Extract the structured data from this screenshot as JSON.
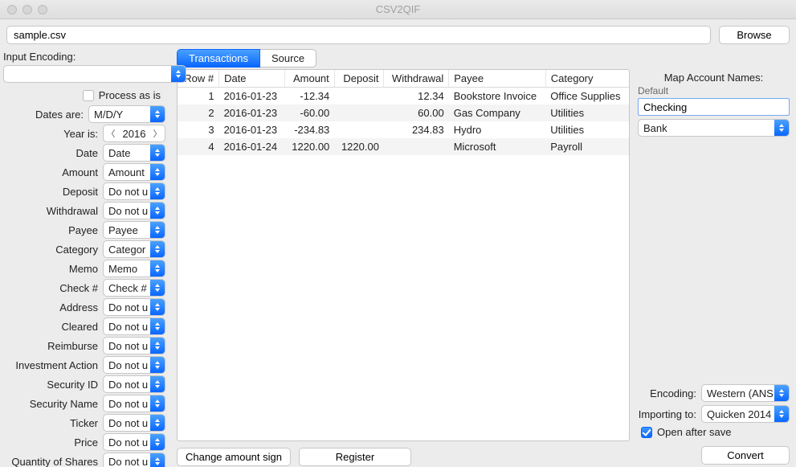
{
  "window": {
    "title": "CSV2QIF"
  },
  "file": {
    "path": "sample.csv",
    "browse": "Browse"
  },
  "left": {
    "input_encoding_label": "Input Encoding:",
    "input_encoding_value": "",
    "process_as_is": "Process as is",
    "dates_are_label": "Dates are:",
    "dates_are_value": "M/D/Y",
    "year_is_label": "Year is:",
    "year_value": "2016",
    "fields": [
      {
        "label": "Date",
        "value": "Date"
      },
      {
        "label": "Amount",
        "value": "Amount"
      },
      {
        "label": "Deposit",
        "value": "Do not u"
      },
      {
        "label": "Withdrawal",
        "value": "Do not u"
      },
      {
        "label": "Payee",
        "value": "Payee"
      },
      {
        "label": "Category",
        "value": "Categor"
      },
      {
        "label": "Memo",
        "value": "Memo"
      },
      {
        "label": "Check #",
        "value": "Check #"
      },
      {
        "label": "Address",
        "value": "Do not u"
      },
      {
        "label": "Cleared",
        "value": "Do not u"
      },
      {
        "label": "Reimburse",
        "value": "Do not u"
      },
      {
        "label": "Investment Action",
        "value": "Do not u"
      },
      {
        "label": "Security ID",
        "value": "Do not u"
      },
      {
        "label": "Security Name",
        "value": "Do not u"
      },
      {
        "label": "Ticker",
        "value": "Do not u"
      },
      {
        "label": "Price",
        "value": "Do not u"
      },
      {
        "label": "Quantity of Shares",
        "value": "Do not u"
      }
    ]
  },
  "tabs": {
    "transactions": "Transactions",
    "source": "Source"
  },
  "table": {
    "headers": [
      "Row #",
      "Date",
      "Amount",
      "Deposit",
      "Withdrawal",
      "Payee",
      "Category"
    ],
    "rows": [
      {
        "rownum": "1",
        "date": "2016-01-23",
        "amount": "-12.34",
        "deposit": "",
        "withdrawal": "12.34",
        "payee": "Bookstore Invoice",
        "category": "Office Supplies"
      },
      {
        "rownum": "2",
        "date": "2016-01-23",
        "amount": "-60.00",
        "deposit": "",
        "withdrawal": "60.00",
        "payee": "Gas Company",
        "category": "Utilities"
      },
      {
        "rownum": "3",
        "date": "2016-01-23",
        "amount": "-234.83",
        "deposit": "",
        "withdrawal": "234.83",
        "payee": "Hydro",
        "category": "Utilities"
      },
      {
        "rownum": "4",
        "date": "2016-01-24",
        "amount": "1220.00",
        "deposit": "1220.00",
        "withdrawal": "",
        "payee": "Microsoft",
        "category": "Payroll"
      }
    ]
  },
  "center_bottom": {
    "change_sign": "Change amount sign",
    "register": "Register"
  },
  "right": {
    "map_title": "Map Account Names:",
    "default_label": "Default",
    "account_name": "Checking",
    "account_type": "Bank",
    "encoding_label": "Encoding:",
    "encoding_value": "Western (ANS",
    "importing_label": "Importing to:",
    "importing_value": "Quicken 2014",
    "open_after_save": "Open after save",
    "convert": "Convert"
  }
}
